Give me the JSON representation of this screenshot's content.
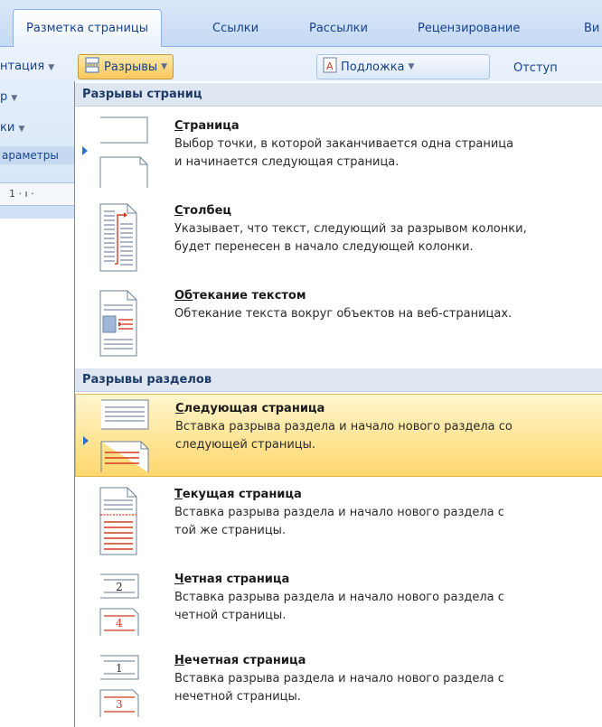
{
  "tabs": {
    "layout": "Разметка страницы",
    "links": "Ссылки",
    "mailings": "Рассылки",
    "review": "Рецензирование",
    "view_partial": "Ви"
  },
  "ribbon": {
    "orientation_partial": "нтация",
    "breaks_button": "Разрывы",
    "watermark_button": "Подложка",
    "indent_label": "Отступ",
    "size_partial": "р",
    "columns_partial": "ки",
    "group_label_partial": "араметры",
    "ruler_text": "1 · ı ·"
  },
  "menu": {
    "section_page_breaks": "Разрывы страниц",
    "section_section_breaks": "Разрывы разделов",
    "items": [
      {
        "title_first": "С",
        "title_rest": "траница",
        "desc1": "Выбор точки, в которой заканчивается одна страница",
        "desc2": "и начинается следующая страница."
      },
      {
        "title_first": "С",
        "title_rest": "толбец",
        "desc1": "Указывает, что текст, следующий за разрывом колонки,",
        "desc2": "будет перенесен в начало следующей колонки."
      },
      {
        "title_first": "Об",
        "title_rest": "текание текстом",
        "desc1": "Обтекание текста вокруг объектов на веб-страницах.",
        "desc2": ""
      },
      {
        "title_first": "С",
        "title_rest": "ледующая страница",
        "desc1": "Вставка разрыва раздела и начало нового раздела со",
        "desc2": "следующей страницы."
      },
      {
        "title_first": "Т",
        "title_rest": "екущая страница",
        "desc1": "Вставка разрыва раздела и начало нового раздела с",
        "desc2": "той же страницы."
      },
      {
        "title_first": "Ч",
        "title_rest": "етная страница",
        "desc1": "Вставка разрыва раздела и начало нового раздела с",
        "desc2": "четной страницы.",
        "icon_top": "2",
        "icon_bottom": "4"
      },
      {
        "title_first": "Н",
        "title_rest": "ечетная страница",
        "desc1": "Вставка разрыва раздела и начало нового раздела с",
        "desc2": "нечетной страницы.",
        "icon_top": "1",
        "icon_bottom": "3"
      }
    ]
  },
  "colors": {
    "highlight": "#ffe391",
    "accent_red": "#d63a1e",
    "accent_blue": "#2c6fc7"
  }
}
